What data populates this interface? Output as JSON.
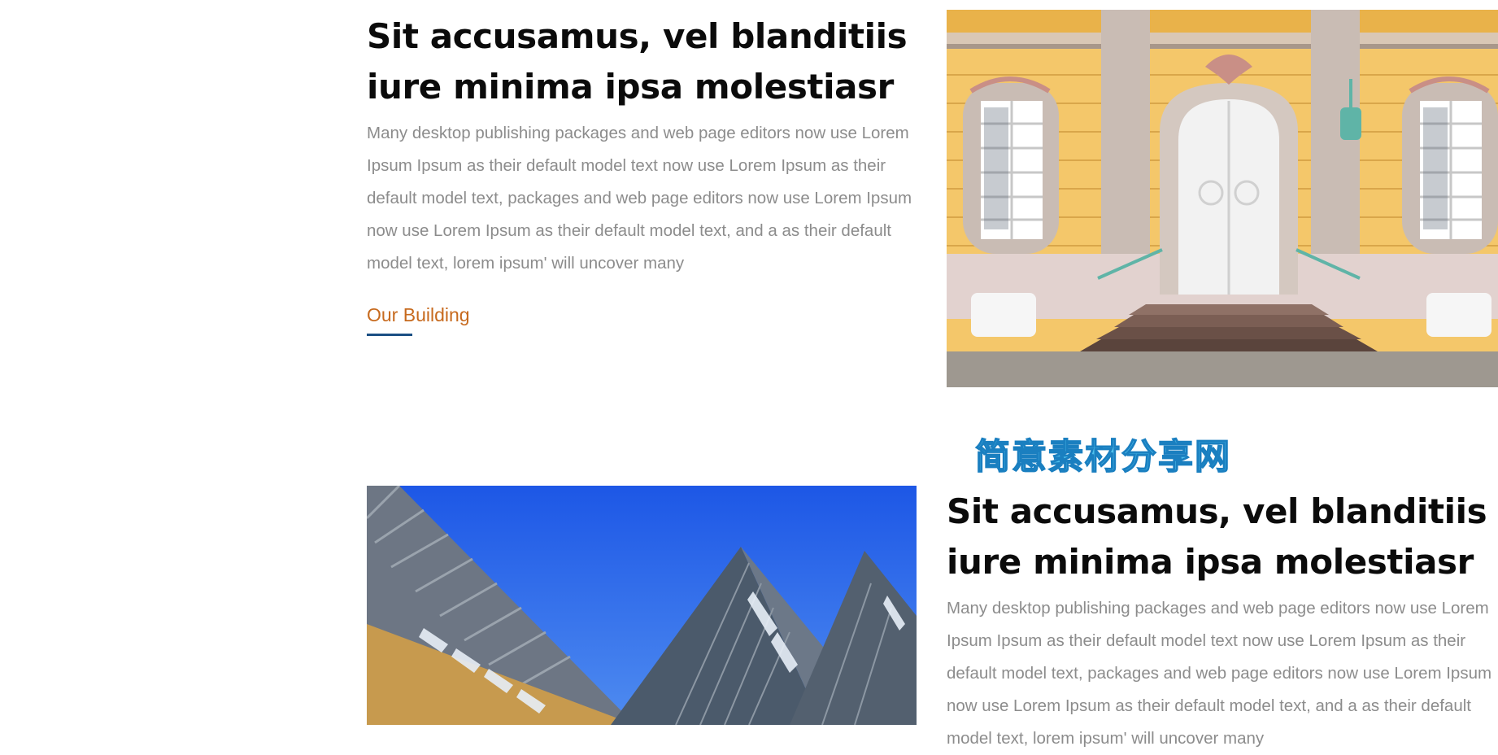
{
  "feature_1": {
    "title": "Sit accusamus, vel blanditiis iure minima ipsa molestiasr",
    "body": "Many desktop publishing packages and web page editors now use Lorem Ipsum Ipsum as their default model text now use Lorem Ipsum as their default model text, packages and web page editors now use Lorem Ipsum now use Lorem Ipsum as their default model text, and a as their default model text, lorem ipsum' will uncover many",
    "link_label": "Our Building"
  },
  "feature_2": {
    "title": "Sit accusamus, vel blanditiis iure minima ipsa molestiasr",
    "body": "Many desktop publishing packages and web page editors now use Lorem Ipsum Ipsum as their default model text now use Lorem Ipsum as their default model text, packages and web page editors now use Lorem Ipsum now use Lorem Ipsum as their default model text, and a as their default model text, lorem ipsum' will uncover many"
  },
  "watermark": "简意素材分享网",
  "colors": {
    "link": "#c76a1e",
    "link_underline": "#1b4f84",
    "title": "#0b0b0b",
    "body_text": "#8c8c8c",
    "watermark": "#4fc0ec"
  }
}
